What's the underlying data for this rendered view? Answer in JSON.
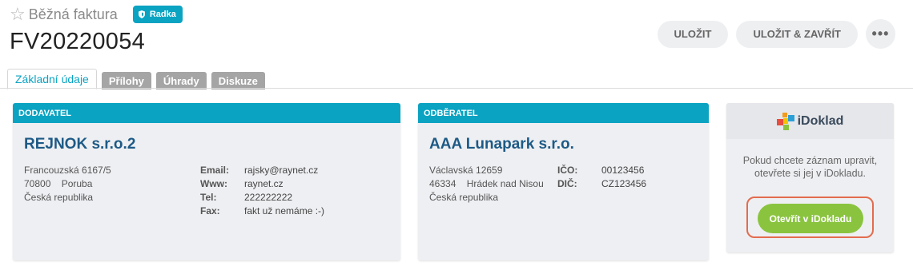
{
  "header": {
    "doc_type": "Běžná faktura",
    "owner_badge": "Radka",
    "doc_number": "FV20220054"
  },
  "actions": {
    "save": "ULOŽIT",
    "save_close": "ULOŽIT & ZAVŘÍT",
    "more": "•••"
  },
  "tabs": [
    {
      "label": "Základní údaje",
      "active": true
    },
    {
      "label": "Přílohy",
      "active": false
    },
    {
      "label": "Úhrady",
      "active": false
    },
    {
      "label": "Diskuze",
      "active": false
    }
  ],
  "supplier": {
    "heading": "DODAVATEL",
    "name": "REJNOK s.r.o.2",
    "address": [
      "Francouzská 6167/5",
      "70800    Poruba",
      "Česká republika"
    ],
    "contact": [
      {
        "key": "Email:",
        "value": "rajsky@raynet.cz"
      },
      {
        "key": "Www:",
        "value": "raynet.cz"
      },
      {
        "key": "Tel:",
        "value": "222222222"
      },
      {
        "key": "Fax:",
        "value": "fakt už nemáme :-)"
      }
    ]
  },
  "customer": {
    "heading": "ODBĚRATEL",
    "name": "AAA Lunapark s.r.o.",
    "address": [
      "Václavská 12659",
      "46334    Hrádek nad Nisou",
      "Česká republika"
    ],
    "ids": [
      {
        "key": "IČO:",
        "value": "00123456"
      },
      {
        "key": "DIČ:",
        "value": "CZ123456"
      }
    ]
  },
  "idoklad": {
    "logo_text": "iDoklad",
    "message": "Pokud chcete záznam upravit, otevřete si jej v iDokladu.",
    "open_button": "Otevřít v iDokladu"
  },
  "colors": {
    "accent": "#0aa3c2",
    "company_name": "#1d5a86",
    "open_button": "#8ac43f",
    "highlight": "#e36c4f"
  }
}
